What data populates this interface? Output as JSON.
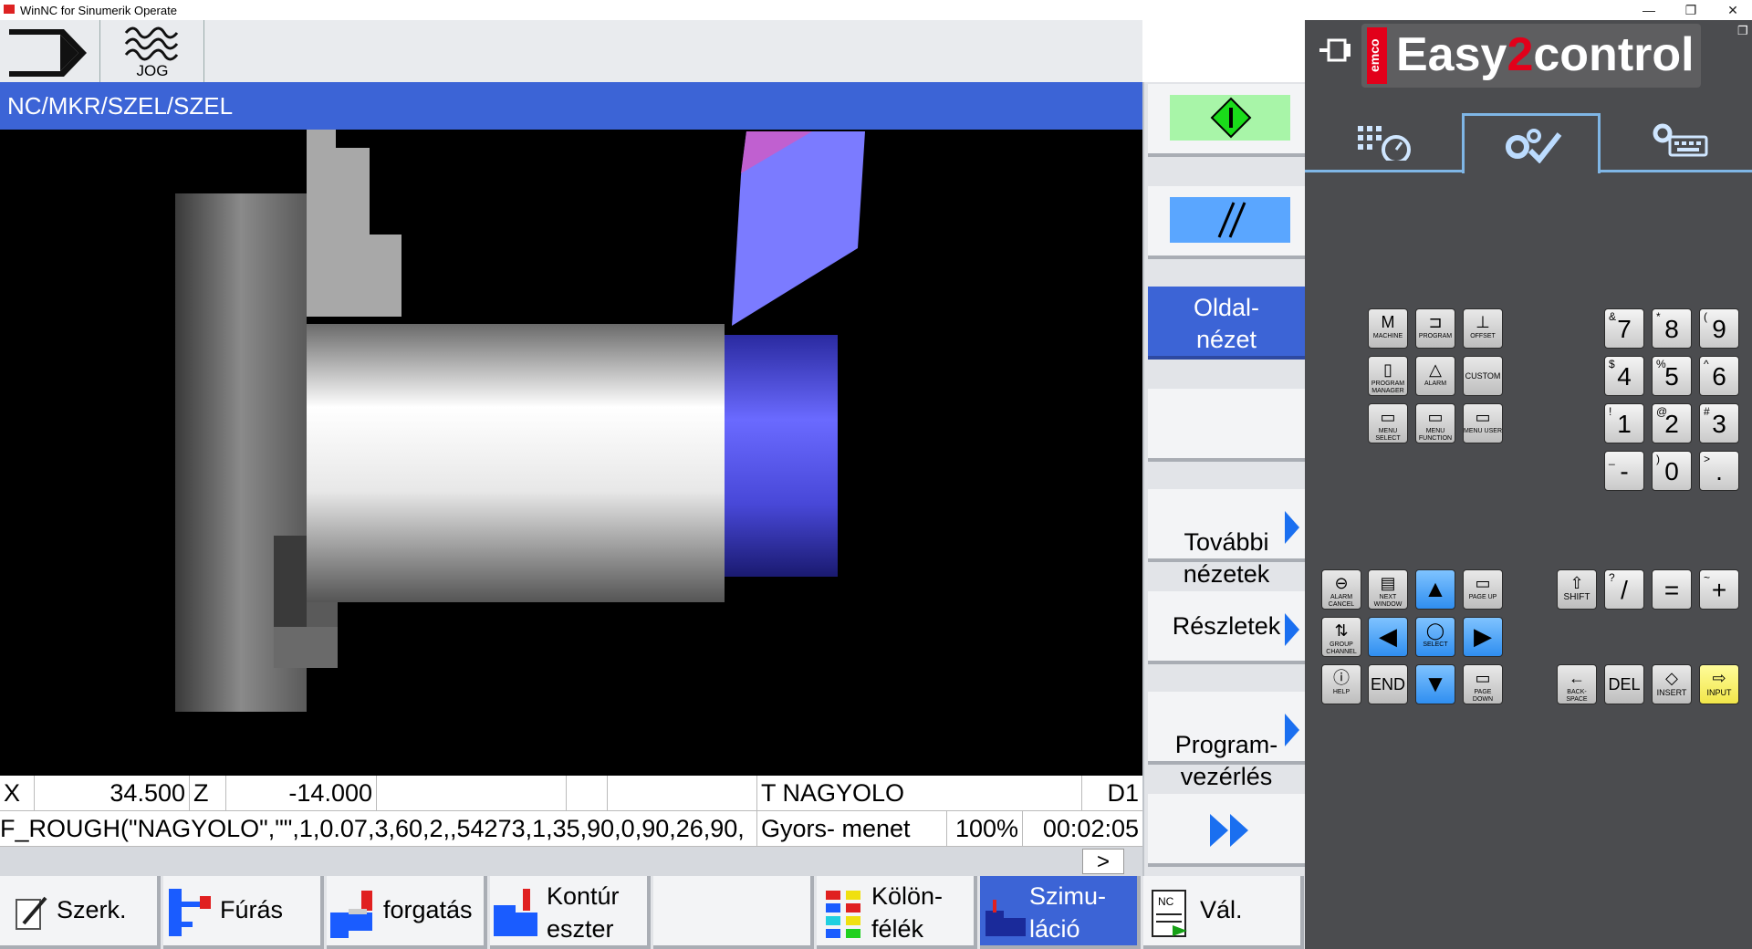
{
  "window": {
    "title": "WinNC for Sinumerik Operate"
  },
  "mode": {
    "jog_label": "JOG"
  },
  "path": "NC/MKR/SZEL/SZEL",
  "status": {
    "x_label": "X",
    "x_value": "34.500",
    "z_label": "Z",
    "z_value": "-14.000",
    "tool": "T NAGYOLO",
    "d": "D1",
    "program_line": "F_ROUGH(\"NAGYOLO\",\"\",1,0.07,3,60,2,,54273,1,35,90,0,90,26,90,",
    "feed_mode": "Gyors- menet",
    "override": "100%",
    "time": "00:02:05",
    "more": ">"
  },
  "vertical_softkeys": {
    "oldalnezet": "Oldal-\nnézet",
    "tovabbi": "További\nnézetek",
    "reszletek": "Részletek",
    "program": "Program-\nvezérlés"
  },
  "horizontal_softkeys": {
    "szerk": "Szerk.",
    "furas": "Fúrás",
    "forgatas": "forgatás",
    "kontur": "Kontúr\neszter",
    "kulon": "Kölön-\nfélék",
    "szimu": "Szimu-\nláció",
    "val": "Vál.",
    "nc_badge": "NC"
  },
  "panel": {
    "brand_emco": "emco",
    "brand_easy": "Easy",
    "brand_2": "2",
    "brand_control": "control",
    "accent_color": "#e2001a"
  },
  "keys": {
    "machine": "MACHINE",
    "program": "PROGRAM",
    "offset": "OFFSET",
    "program_manager": "PROGRAM MANAGER",
    "alarm": "ALARM",
    "custom": "CUSTOM",
    "menu_select": "MENU SELECT",
    "menu_function": "MENU FUNCTION",
    "menu_user": "MENU USER",
    "alarm_cancel": "ALARM CANCEL",
    "next_window": "NEXT WINDOW",
    "page_up": "PAGE UP",
    "group_channel": "GROUP CHANNEL",
    "select": "SELECT",
    "help": "HELP",
    "end": "END",
    "page_down": "PAGE DOWN",
    "shift": "SHIFT",
    "backspace": "BACK-SPACE",
    "del": "DEL",
    "insert": "INSERT",
    "input": "INPUT"
  },
  "numpad": [
    {
      "main": "7",
      "sup": "&"
    },
    {
      "main": "8",
      "sup": "*"
    },
    {
      "main": "9",
      "sup": "("
    },
    {
      "main": "4",
      "sup": "$"
    },
    {
      "main": "5",
      "sup": "%"
    },
    {
      "main": "6",
      "sup": "^"
    },
    {
      "main": "1",
      "sup": "!"
    },
    {
      "main": "2",
      "sup": "@"
    },
    {
      "main": "3",
      "sup": "#"
    },
    {
      "main": "-",
      "sup": "_"
    },
    {
      "main": "0",
      "sup": ")"
    },
    {
      "main": ".",
      "sup": ">"
    },
    {
      "main": "/",
      "sup": "?"
    },
    {
      "main": "=",
      "sup": ""
    },
    {
      "main": "+",
      "sup": "~"
    }
  ]
}
